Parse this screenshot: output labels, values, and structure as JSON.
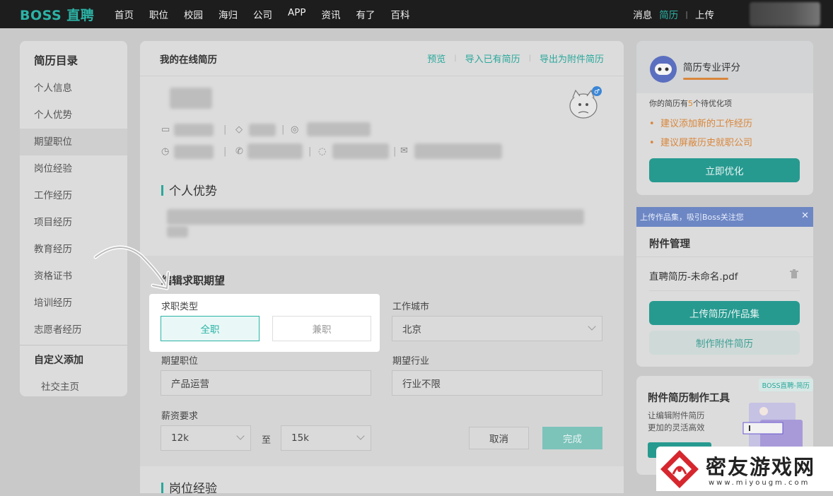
{
  "topbar": {
    "logo": "BOSS 直聘",
    "nav": [
      "首页",
      "职位",
      "校园",
      "海归",
      "公司",
      "APP",
      "资讯",
      "有了",
      "百科"
    ],
    "right": {
      "messages": "消息",
      "resume": "简历",
      "upload": "上传"
    }
  },
  "sidebar": {
    "title": "简历目录",
    "items": [
      "个人信息",
      "个人优势",
      "期望职位",
      "岗位经验",
      "工作经历",
      "项目经历",
      "教育经历",
      "资格证书",
      "培训经历",
      "志愿者经历"
    ],
    "selected_index": 2,
    "custom_title": "自定义添加",
    "custom_items": [
      "社交主页"
    ]
  },
  "main": {
    "header_title": "我的在线简历",
    "links": [
      "预览",
      "导入已有简历",
      "导出为附件简历"
    ],
    "section_advantage": "个人优势",
    "edit_title": "编辑求职期望",
    "job_type_label": "求职类型",
    "job_type_options": [
      "全职",
      "兼职"
    ],
    "job_type_selected": "全职",
    "city_label": "工作城市",
    "city_value": "北京",
    "position_label": "期望职位",
    "position_value": "产品运营",
    "industry_label": "期望行业",
    "industry_value": "行业不限",
    "salary_label": "薪资要求",
    "salary_min": "12k",
    "salary_to": "至",
    "salary_max": "15k",
    "cancel_label": "取消",
    "done_label": "完成",
    "section_post_exp": "岗位经验"
  },
  "score_card": {
    "title": "简历专业评分",
    "summary_prefix": "你的简历有",
    "summary_count": "5",
    "summary_suffix": "个待优化项",
    "suggestions": [
      "建议添加新的工作经历",
      "建议屏蔽历史就职公司"
    ],
    "optimize_button": "立即优化"
  },
  "attachment": {
    "banner": "上传作品集，吸引Boss关注您",
    "title": "附件管理",
    "file_name": "直聘简历-未命名.pdf",
    "upload_button": "上传简历/作品集",
    "make_button": "制作附件简历"
  },
  "tool_card": {
    "badge": "BOSS直聘-简历",
    "title": "附件简历制作工具",
    "desc_line1": "让编辑附件简历",
    "desc_line2": "更加的灵活高效"
  },
  "watermark": {
    "text": "密友游戏网",
    "url": "www.miyougm.com"
  },
  "colors": {
    "accent": "#2cb3a6",
    "topbar": "#1d1d1d",
    "warning": "#e08a2a",
    "banner": "#6d87c4"
  }
}
